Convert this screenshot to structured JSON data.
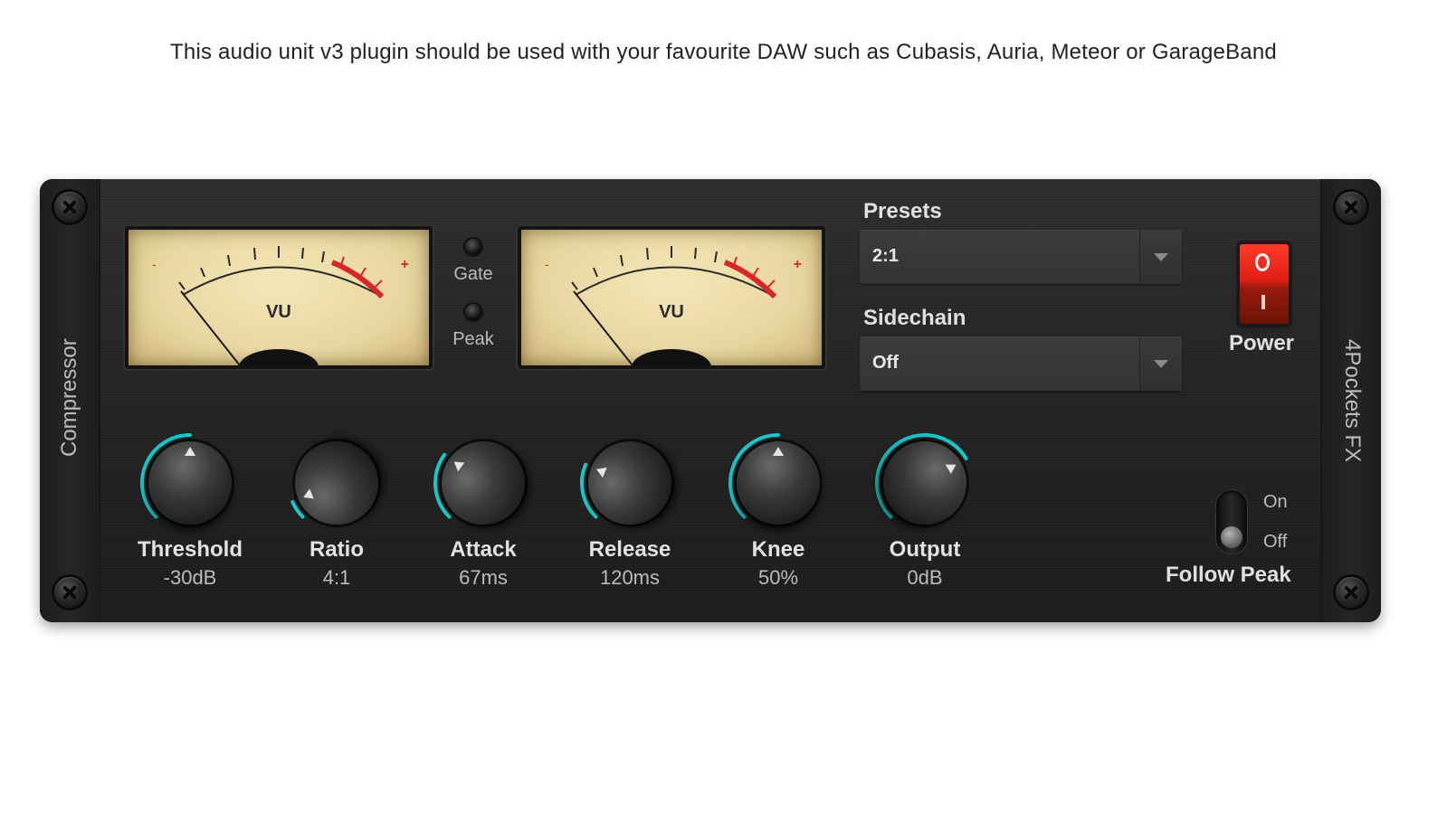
{
  "caption": "This audio unit v3 plugin should be used with your favourite DAW such as Cubasis, Auria, Meteor or GarageBand",
  "plugin": {
    "name": "Compressor",
    "brand": "4Pockets FX"
  },
  "meters": [
    {
      "label": "VU",
      "minus": "-",
      "plus": "+"
    },
    {
      "label": "VU",
      "minus": "-",
      "plus": "+"
    }
  ],
  "indicators": {
    "gate_label": "Gate",
    "peak_label": "Peak"
  },
  "presets": {
    "label": "Presets",
    "value": "2:1"
  },
  "sidechain": {
    "label": "Sidechain",
    "value": "Off"
  },
  "power": {
    "label": "Power",
    "state": "on"
  },
  "knobs": [
    {
      "label": "Threshold",
      "value": "-30dB",
      "level": 0.5
    },
    {
      "label": "Ratio",
      "value": "4:1",
      "level": 0.08
    },
    {
      "label": "Attack",
      "value": "67ms",
      "level": 0.3
    },
    {
      "label": "Release",
      "value": "120ms",
      "level": 0.25
    },
    {
      "label": "Knee",
      "value": "50%",
      "level": 0.5
    },
    {
      "label": "Output",
      "value": "0dB",
      "level": 0.72
    }
  ],
  "follow_peak": {
    "label": "Follow Peak",
    "on_label": "On",
    "off_label": "Off",
    "state": "off"
  },
  "colors": {
    "knob_arc": "#19c6c9",
    "meter_red": "#d8262a",
    "power_red": "#e01e14"
  }
}
